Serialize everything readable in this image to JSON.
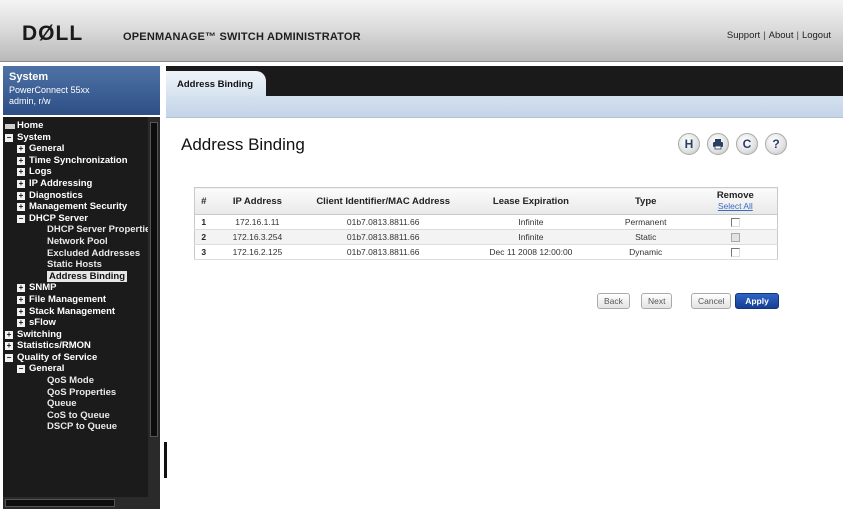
{
  "header": {
    "brand": "DØLL",
    "product": "OPENMANAGE™ SWITCH ADMINISTRATOR",
    "links": [
      "Support",
      "About",
      "Logout"
    ]
  },
  "system": {
    "title": "System",
    "model": "PowerConnect 55xx",
    "user": "admin, r/w"
  },
  "tree": [
    {
      "label": "Home",
      "depth": 0,
      "marker": "home"
    },
    {
      "label": "System",
      "depth": 0,
      "marker": "minus"
    },
    {
      "label": "General",
      "depth": 1,
      "marker": "plus"
    },
    {
      "label": "Time Synchronization",
      "depth": 1,
      "marker": "plus"
    },
    {
      "label": "Logs",
      "depth": 1,
      "marker": "plus"
    },
    {
      "label": "IP Addressing",
      "depth": 1,
      "marker": "plus"
    },
    {
      "label": "Diagnostics",
      "depth": 1,
      "marker": "plus"
    },
    {
      "label": "Management Security",
      "depth": 1,
      "marker": "plus"
    },
    {
      "label": "DHCP Server",
      "depth": 1,
      "marker": "minus"
    },
    {
      "label": "DHCP Server Properties",
      "depth": 2,
      "marker": "none"
    },
    {
      "label": "Network Pool",
      "depth": 2,
      "marker": "none"
    },
    {
      "label": "Excluded Addresses",
      "depth": 2,
      "marker": "none"
    },
    {
      "label": "Static Hosts",
      "depth": 2,
      "marker": "none"
    },
    {
      "label": "Address Binding",
      "depth": 2,
      "marker": "none",
      "selected": true
    },
    {
      "label": "SNMP",
      "depth": 1,
      "marker": "plus"
    },
    {
      "label": "File Management",
      "depth": 1,
      "marker": "plus"
    },
    {
      "label": "Stack Management",
      "depth": 1,
      "marker": "plus"
    },
    {
      "label": "sFlow",
      "depth": 1,
      "marker": "plus"
    },
    {
      "label": "Switching",
      "depth": 0,
      "marker": "plus"
    },
    {
      "label": "Statistics/RMON",
      "depth": 0,
      "marker": "plus"
    },
    {
      "label": "Quality of Service",
      "depth": 0,
      "marker": "minus"
    },
    {
      "label": "General",
      "depth": 1,
      "marker": "minus"
    },
    {
      "label": "QoS Mode",
      "depth": 2,
      "marker": "none"
    },
    {
      "label": "QoS Properties",
      "depth": 2,
      "marker": "none"
    },
    {
      "label": "Queue",
      "depth": 2,
      "marker": "none"
    },
    {
      "label": "CoS to Queue",
      "depth": 2,
      "marker": "none"
    },
    {
      "label": "DSCP to Queue",
      "depth": 2,
      "marker": "none"
    }
  ],
  "tab": {
    "label": "Address Binding"
  },
  "page": {
    "title": "Address Binding"
  },
  "toolbar_icons": [
    "save-icon",
    "print-icon",
    "refresh-icon",
    "help-icon"
  ],
  "table": {
    "headers": [
      "#",
      "IP Address",
      "Client Identifier/MAC Address",
      "Lease Expiration",
      "Type",
      "Remove"
    ],
    "select_all": "Select All",
    "rows": [
      {
        "num": "1",
        "ip": "172.16.1.11",
        "mac": "01b7.0813.8811.66",
        "lease": "Infinite",
        "type": "Permanent",
        "remove_enabled": true
      },
      {
        "num": "2",
        "ip": "172.16.3.254",
        "mac": "01b7.0813.8811.66",
        "lease": "Infinite",
        "type": "Static",
        "remove_enabled": false
      },
      {
        "num": "3",
        "ip": "172.16.2.125",
        "mac": "01b7.0813.8811.66",
        "lease": "Dec 11 2008 12:00:00",
        "type": "Dynamic",
        "remove_enabled": true
      }
    ]
  },
  "buttons": {
    "back": "Back",
    "next": "Next",
    "cancel": "Cancel",
    "apply": "Apply"
  },
  "colors": {
    "sidebar": "#1b1b1b",
    "accent": "#2d4f86",
    "apply": "#1f4fae"
  }
}
